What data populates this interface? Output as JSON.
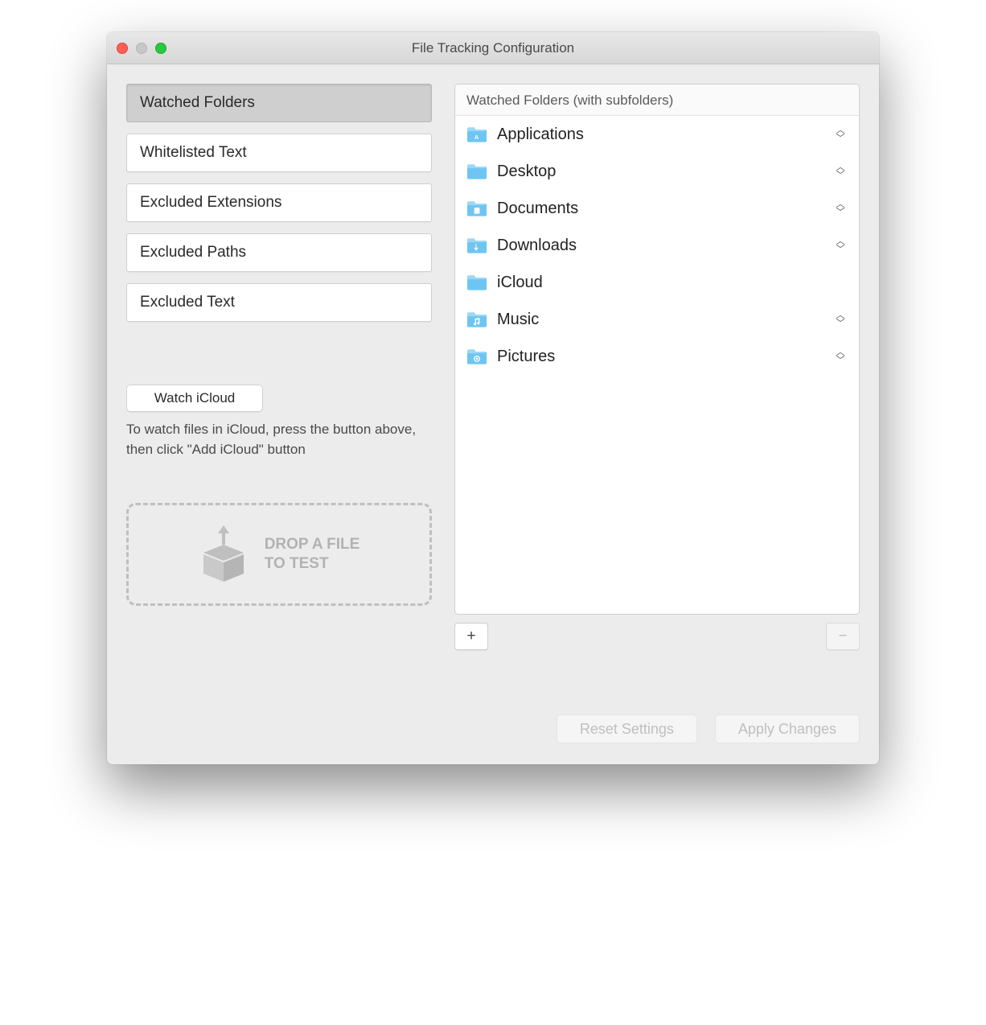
{
  "window": {
    "title": "File Tracking Configuration"
  },
  "sidebar": {
    "items": [
      {
        "label": "Watched Folders",
        "active": true
      },
      {
        "label": "Whitelisted Text",
        "active": false
      },
      {
        "label": "Excluded Extensions",
        "active": false
      },
      {
        "label": "Excluded Paths",
        "active": false
      },
      {
        "label": "Excluded Text",
        "active": false
      }
    ],
    "icloud_button": "Watch iCloud",
    "icloud_help": "To watch files in iCloud, press the button above, then click \"Add iCloud\" button",
    "dropzone": "DROP A FILE\nTO TEST"
  },
  "panel": {
    "header": "Watched Folders (with subfolders)",
    "folders": [
      {
        "name": "Applications",
        "icon": "apps",
        "stepper": true
      },
      {
        "name": "Desktop",
        "icon": "folder",
        "stepper": true
      },
      {
        "name": "Documents",
        "icon": "docs",
        "stepper": true
      },
      {
        "name": "Downloads",
        "icon": "downloads",
        "stepper": true
      },
      {
        "name": "iCloud",
        "icon": "folder",
        "stepper": false
      },
      {
        "name": "Music",
        "icon": "music",
        "stepper": true
      },
      {
        "name": "Pictures",
        "icon": "pictures",
        "stepper": true
      }
    ],
    "add_label": "+",
    "remove_label": "−"
  },
  "footer": {
    "reset": "Reset Settings",
    "apply": "Apply Changes"
  }
}
